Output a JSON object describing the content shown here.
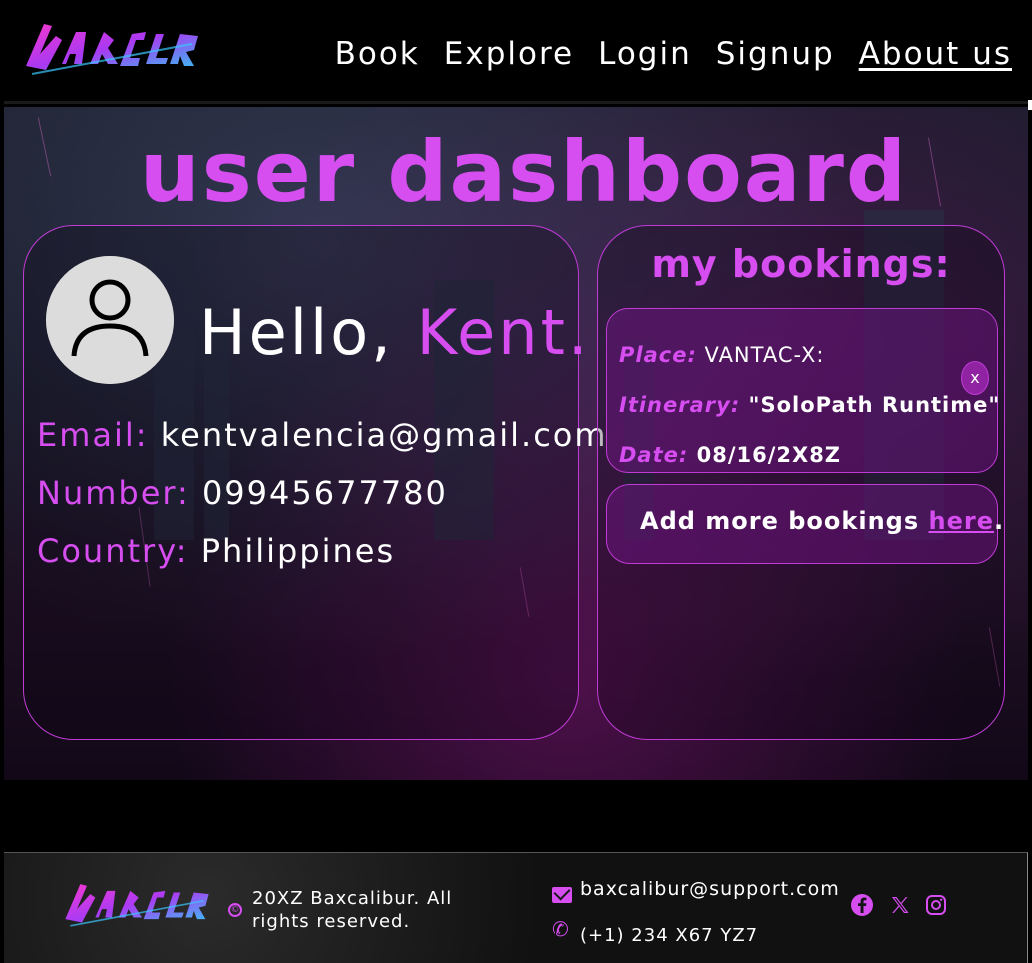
{
  "nav": {
    "brand": "Baxcalibur",
    "links": [
      "Book",
      "Explore",
      "Login",
      "Signup",
      "About us"
    ]
  },
  "dashboard": {
    "title": "user dashboard",
    "greeting": "Hello,",
    "user_name": "Kent.",
    "email_label": "Email:",
    "email_value": "kentvalencia@gmail.com",
    "number_label": "Number:",
    "number_value": "09945677780",
    "country_label": "Country:",
    "country_value": "Philippines"
  },
  "bookings": {
    "title": "my bookings:",
    "items": [
      {
        "place_label": "Place:",
        "place_value": "VANTAC-X:",
        "itinerary_label": "Itinerary:",
        "itinerary_value": "\"SoloPath Runtime\"",
        "date_label": "Date:",
        "date_value": "08/16/2X8Z",
        "close_label": "x"
      }
    ],
    "add_more_text": "Add more bookings",
    "add_more_link": "here",
    "add_more_suffix": "."
  },
  "footer": {
    "copyright": "20XZ Baxcalibur. All rights reserved.",
    "email": "baxcalibur@support.com",
    "phone": "(+1) 234 X67 YZ7",
    "social_icons": [
      "facebook-icon",
      "x-twitter-icon",
      "instagram-icon"
    ]
  },
  "colors": {
    "accent": "#d64df0",
    "card_border": "#c03bd6",
    "background": "#000000"
  }
}
